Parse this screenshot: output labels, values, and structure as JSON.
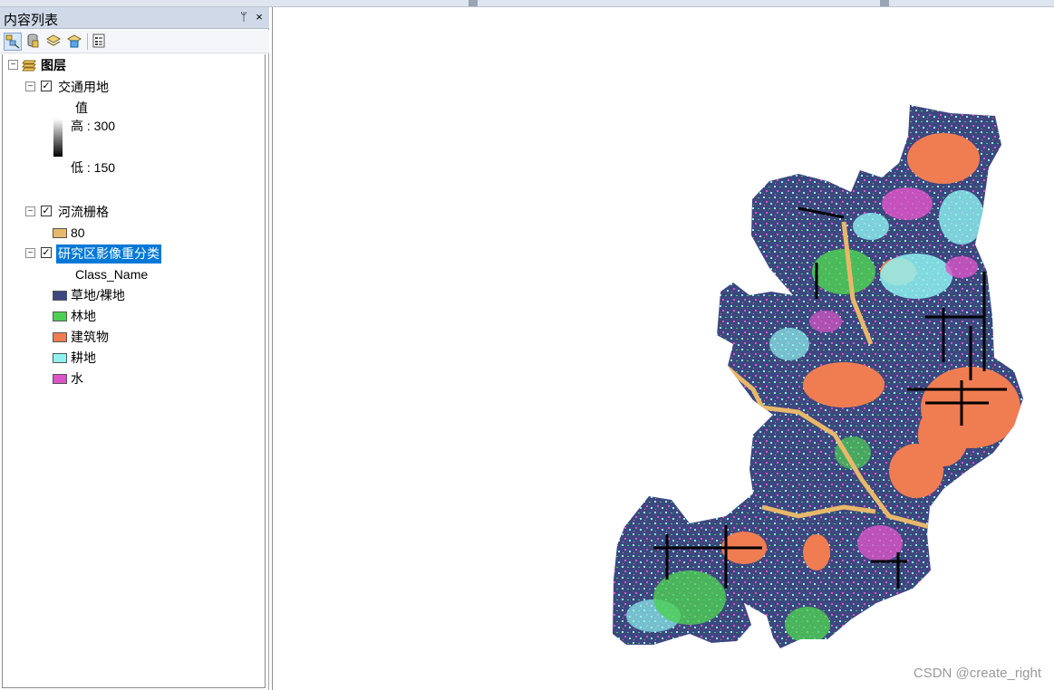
{
  "toc": {
    "title": "内容列表",
    "pin_glyph": "ᛘ",
    "close_glyph": "×",
    "toolbar": [
      {
        "icon": "list-by-drawing-order-icon",
        "active": true
      },
      {
        "icon": "list-by-source-icon",
        "active": false
      },
      {
        "icon": "list-by-visibility-icon",
        "active": false
      },
      {
        "icon": "list-by-selection-icon",
        "active": false
      },
      {
        "icon": "options-icon",
        "active": false
      }
    ],
    "root": {
      "label": "图层",
      "expander": "−"
    },
    "layers": [
      {
        "name": "交通用地",
        "checked": true,
        "expander": "−",
        "legend_heading": "值",
        "high_label": "高 : 300",
        "low_label": "低 : 150"
      },
      {
        "name": "河流栅格",
        "checked": true,
        "expander": "−",
        "classes": [
          {
            "label": "80",
            "color": "#e8b86a"
          }
        ]
      },
      {
        "name": "研究区影像重分类",
        "checked": true,
        "selected": true,
        "expander": "−",
        "field": "Class_Name",
        "classes": [
          {
            "label": "草地/裸地",
            "color": "#3d4780"
          },
          {
            "label": "林地",
            "color": "#4ecf54"
          },
          {
            "label": "建筑物",
            "color": "#f07d52"
          },
          {
            "label": "耕地",
            "color": "#8ef2f0"
          },
          {
            "label": "水",
            "color": "#db55c8"
          }
        ]
      }
    ]
  },
  "map": {
    "watermark": "CSDN @create_right",
    "colors": {
      "grass": "#3d4780",
      "forest": "#4ecf54",
      "building": "#f07d52",
      "farmland": "#8ef2f0",
      "water": "#db55c8",
      "river": "#e8b86a",
      "transport": "#000000"
    }
  }
}
